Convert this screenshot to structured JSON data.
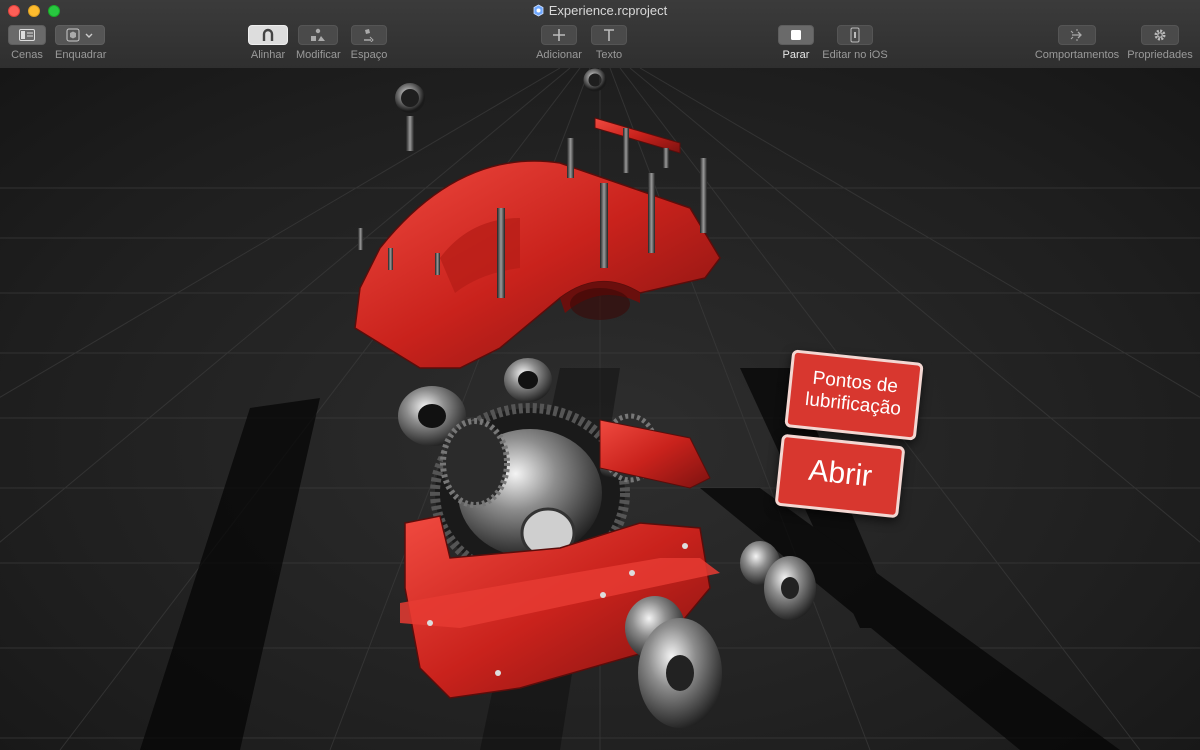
{
  "window": {
    "title": "Experience.rcproject"
  },
  "toolbar": {
    "scenes": "Cenas",
    "frame": "Enquadrar",
    "align": "Alinhar",
    "modify": "Modificar",
    "space": "Espaço",
    "add": "Adicionar",
    "text": "Texto",
    "stop": "Parar",
    "edit_ios": "Editar no iOS",
    "behaviors": "Comportamentos",
    "properties": "Propriedades"
  },
  "scene": {
    "lubrication_button": "Pontos de lubrificação",
    "open_button": "Abrir"
  },
  "colors": {
    "accent_red": "#d8372f",
    "toolbar_bg": "#333333",
    "grid": "#3a3a3a"
  }
}
